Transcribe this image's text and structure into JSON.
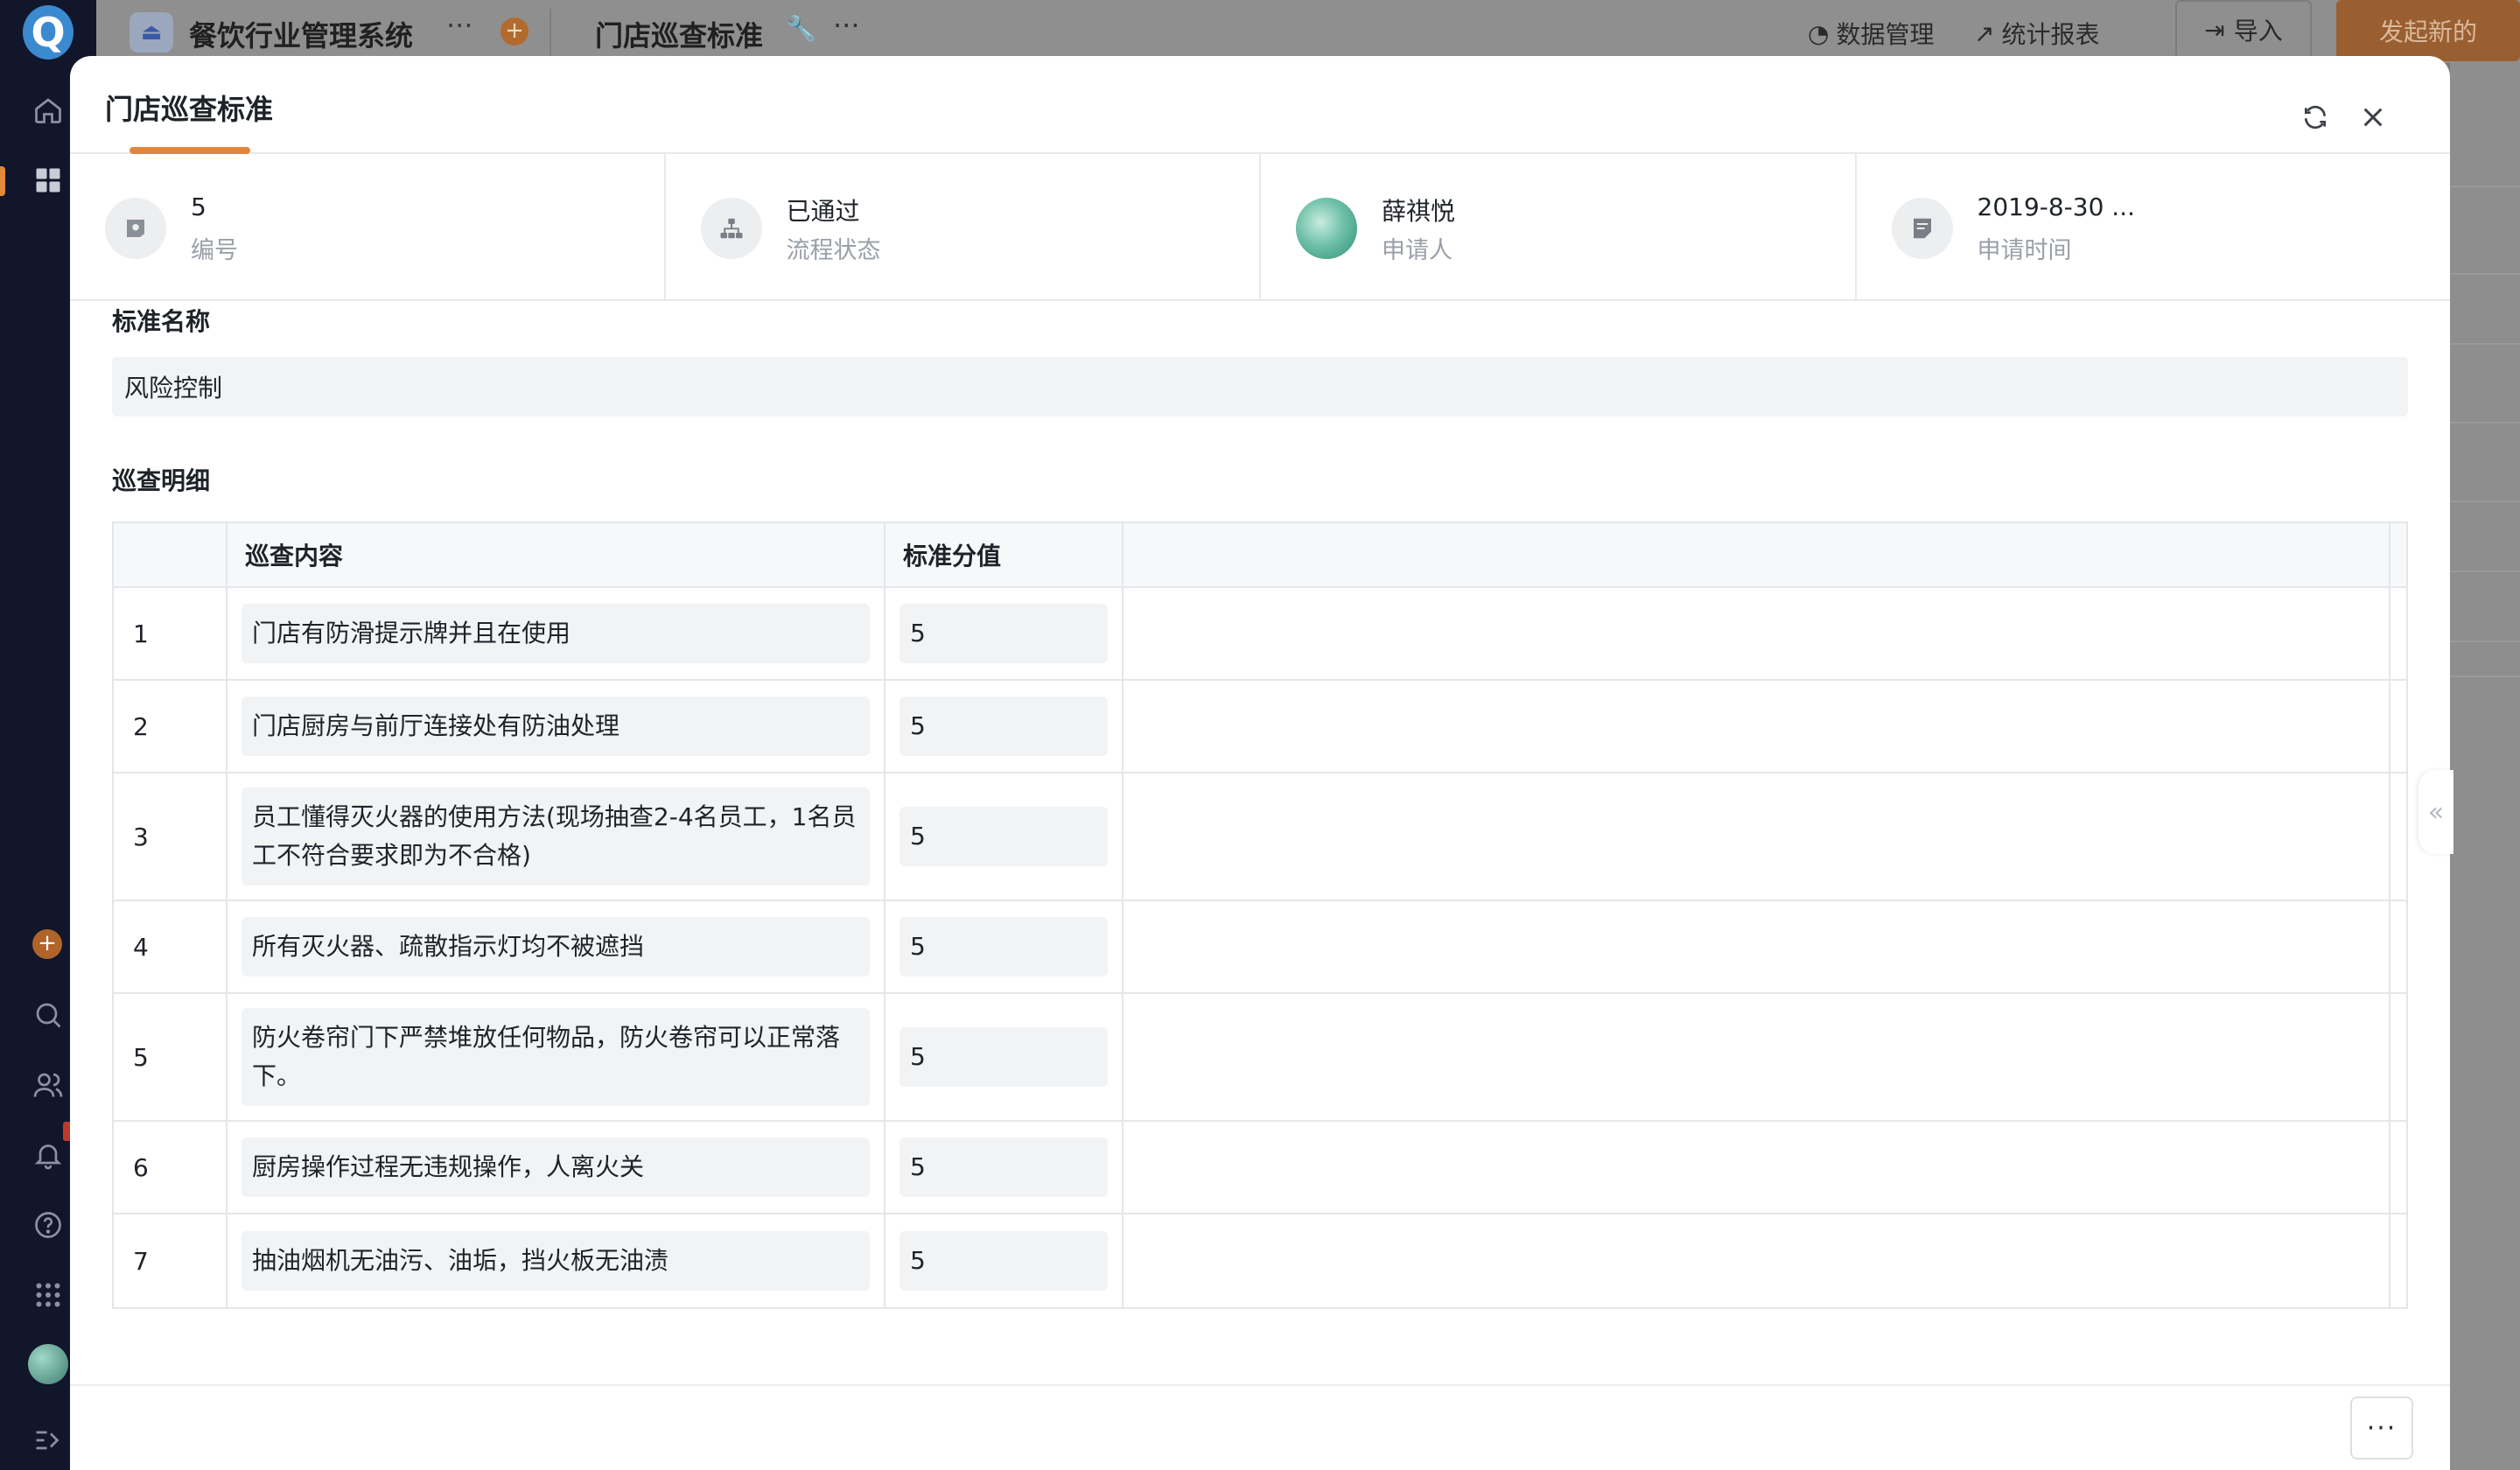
{
  "topbar": {
    "app_name": "餐饮行业管理系统",
    "app_more": "···",
    "app_plus": "+",
    "page_name": "门店巡查标准",
    "page_more": "···",
    "data_manage": "数据管理",
    "stats_report": "统计报表",
    "import": "导入",
    "new": "发起新的"
  },
  "leftnav": {
    "logo": "Q",
    "plus": "+"
  },
  "modal": {
    "title": "门店巡查标准",
    "meta": [
      {
        "value": "5",
        "label": "编号",
        "icon": "id-tag-icon"
      },
      {
        "value": "已通过",
        "label": "流程状态",
        "icon": "flow-tree-icon"
      },
      {
        "value": "薛祺悦",
        "label": "申请人",
        "icon": "avatar"
      },
      {
        "value": "2019-8-30 ...",
        "label": "申请时间",
        "icon": "note-icon"
      }
    ],
    "name_label": "标准名称",
    "name_value": "风险控制",
    "detail_label": "巡查明细",
    "table": {
      "headers": [
        "巡查内容",
        "标准分值"
      ],
      "rows": [
        {
          "idx": "1",
          "content": "门店有防滑提示牌并且在使用",
          "score": "5"
        },
        {
          "idx": "2",
          "content": "门店厨房与前厅连接处有防油处理",
          "score": "5"
        },
        {
          "idx": "3",
          "content": "员工懂得灭火器的使用方法(现场抽查2-4名员工，1名员工不符合要求即为不合格)",
          "score": "5"
        },
        {
          "idx": "4",
          "content": "所有灭火器、疏散指示灯均不被遮挡",
          "score": "5"
        },
        {
          "idx": "5",
          "content": "防火卷帘门下严禁堆放任何物品，防火卷帘可以正常落下。",
          "score": "5"
        },
        {
          "idx": "6",
          "content": "厨房操作过程无违规操作，人离火关",
          "score": "5"
        },
        {
          "idx": "7",
          "content": "抽油烟机无油污、油垢，挡火板无油渍",
          "score": "5"
        }
      ]
    },
    "more": "···",
    "collapse": "«"
  },
  "colors": {
    "accent": "#e2853a",
    "nav_bg": "#12162b",
    "field_bg": "#f2f3f5"
  }
}
